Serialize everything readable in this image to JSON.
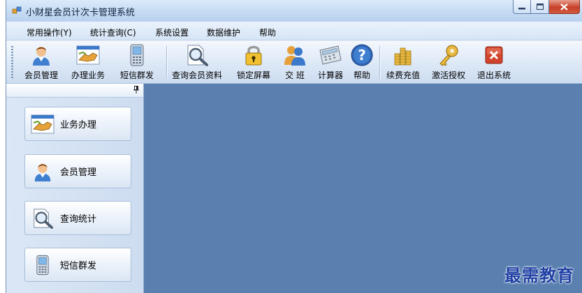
{
  "window": {
    "title": "小财星会员计次卡管理系统"
  },
  "menubar": {
    "items": [
      "常用操作(Y)",
      "统计查询(C)",
      "系统设置",
      "数据维护",
      "帮助"
    ]
  },
  "toolbar": {
    "items": [
      {
        "label": "会员管理",
        "icon": "member-icon"
      },
      {
        "label": "办理业务",
        "icon": "handshake-icon"
      },
      {
        "label": "短信群发",
        "icon": "phone-icon"
      },
      {
        "label": "查询会员资料",
        "icon": "search-document-icon"
      },
      {
        "label": "锁定屏幕",
        "icon": "lock-icon"
      },
      {
        "label": "交 班",
        "icon": "users-icon"
      },
      {
        "label": "计算器",
        "icon": "calculator-icon"
      },
      {
        "label": "帮助",
        "icon": "help-icon"
      },
      {
        "label": "续费充值",
        "icon": "coins-icon"
      },
      {
        "label": "激活授权",
        "icon": "key-icon"
      },
      {
        "label": "退出系统",
        "icon": "exit-icon"
      }
    ]
  },
  "sidebar": {
    "items": [
      {
        "label": "业务办理",
        "icon": "handshake-icon"
      },
      {
        "label": "会员管理",
        "icon": "member-icon"
      },
      {
        "label": "查询统计",
        "icon": "search-document-icon"
      },
      {
        "label": "短信群发",
        "icon": "phone-icon"
      }
    ]
  },
  "watermark": {
    "text": "最需教育"
  },
  "colors": {
    "workspace": "#5a80b0",
    "accent": "#1e3fa3"
  }
}
